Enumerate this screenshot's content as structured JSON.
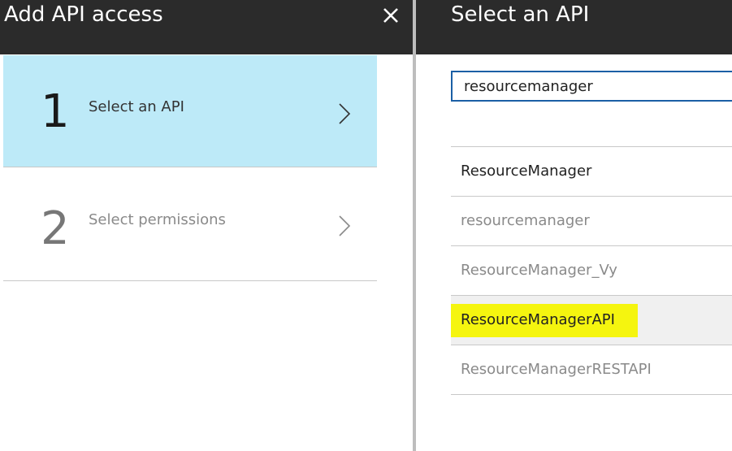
{
  "left_panel": {
    "title": "Add API access",
    "close_label": "✕",
    "steps": [
      {
        "number": "1",
        "label": "Select an API",
        "active": true
      },
      {
        "number": "2",
        "label": "Select permissions",
        "active": false
      }
    ]
  },
  "right_panel": {
    "title": "Select an API",
    "search": {
      "value": "resourcemanager",
      "placeholder": ""
    },
    "results": [
      {
        "label": "ResourceManager"
      },
      {
        "label": "resourcemanager"
      },
      {
        "label": "ResourceManager_Vy"
      },
      {
        "label": "ResourceManagerAPI",
        "highlighted": true
      },
      {
        "label": "ResourceManagerRESTAPI"
      }
    ]
  },
  "colors": {
    "header_bg": "#2b2b2b",
    "active_step_bg": "#bdeaf8",
    "search_border": "#1b5fa5",
    "highlight": "#f5f50f"
  },
  "icons": {
    "close": "close-icon",
    "chevron": "chevron-right-icon"
  }
}
